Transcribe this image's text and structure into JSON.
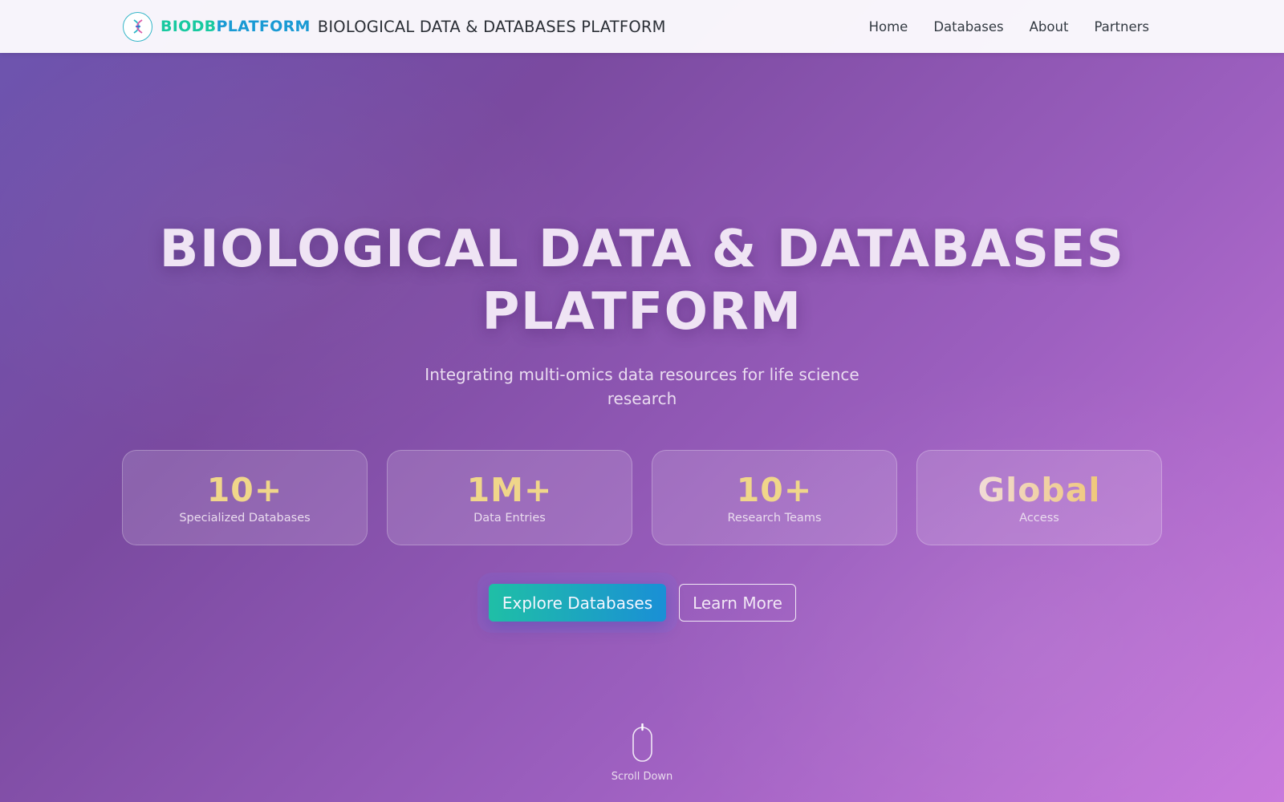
{
  "nav": {
    "brand_part1": "BIODB",
    "brand_part2": "PLATFORM",
    "brand_title": "BIOLOGICAL DATA & DATABASES PLATFORM",
    "links": [
      "Home",
      "Databases",
      "About",
      "Partners"
    ]
  },
  "hero": {
    "title": "BIOLOGICAL DATA & DATABASES PLATFORM",
    "subtitle": "Integrating multi-omics data resources for life science research"
  },
  "stats": [
    {
      "value": "10+",
      "label": "Specialized Databases"
    },
    {
      "value": "1M+",
      "label": "Data Entries"
    },
    {
      "value": "10+",
      "label": "Research Teams"
    },
    {
      "value": "Global",
      "label": "Access"
    }
  ],
  "buttons": {
    "primary": "Explore Databases",
    "secondary": "Learn More"
  },
  "scroll": {
    "label": "Scroll Down"
  },
  "colors": {
    "brand_green": "#18c9a0",
    "brand_blue": "#1a9ad4",
    "stat_gold": "#f0d68a",
    "gradient_start": "#6c55b0",
    "gradient_end": "#c878dc"
  },
  "icons": {
    "logo": "dna-helix-icon",
    "scroll": "mouse-icon"
  }
}
